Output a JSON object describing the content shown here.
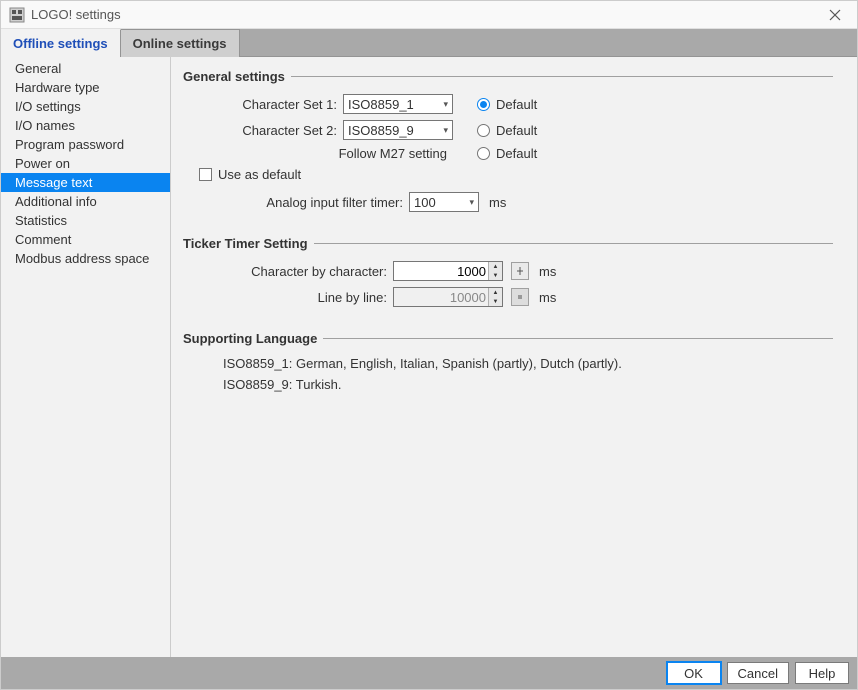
{
  "window": {
    "title": "LOGO! settings"
  },
  "tabs": {
    "offline": "Offline settings",
    "online": "Online settings"
  },
  "sidebar": {
    "items": [
      "General",
      "Hardware type",
      "I/O settings",
      "I/O names",
      "Program password",
      "Power on",
      "Message text",
      "Additional info",
      "Statistics",
      "Comment",
      "Modbus address space"
    ],
    "selectedIndex": 6
  },
  "groups": {
    "general": {
      "title": "General settings",
      "cs1_label": "Character Set 1:",
      "cs1_value": "ISO8859_1",
      "cs2_label": "Character Set 2:",
      "cs2_value": "ISO8859_9",
      "follow_label": "Follow M27 setting",
      "default_label": "Default",
      "use_default": "Use as default",
      "analog_label": "Analog input filter timer:",
      "analog_value": "100",
      "analog_unit": "ms"
    },
    "ticker": {
      "title": "Ticker Timer Setting",
      "char_label": "Character by character:",
      "char_value": "1000",
      "line_label": "Line by line:",
      "line_value": "10000",
      "unit": "ms"
    },
    "lang": {
      "title": "Supporting Language",
      "line1": "ISO8859_1: German, English, Italian, Spanish (partly), Dutch (partly).",
      "line2": "ISO8859_9: Turkish."
    }
  },
  "footer": {
    "ok": "OK",
    "cancel": "Cancel",
    "help": "Help"
  }
}
